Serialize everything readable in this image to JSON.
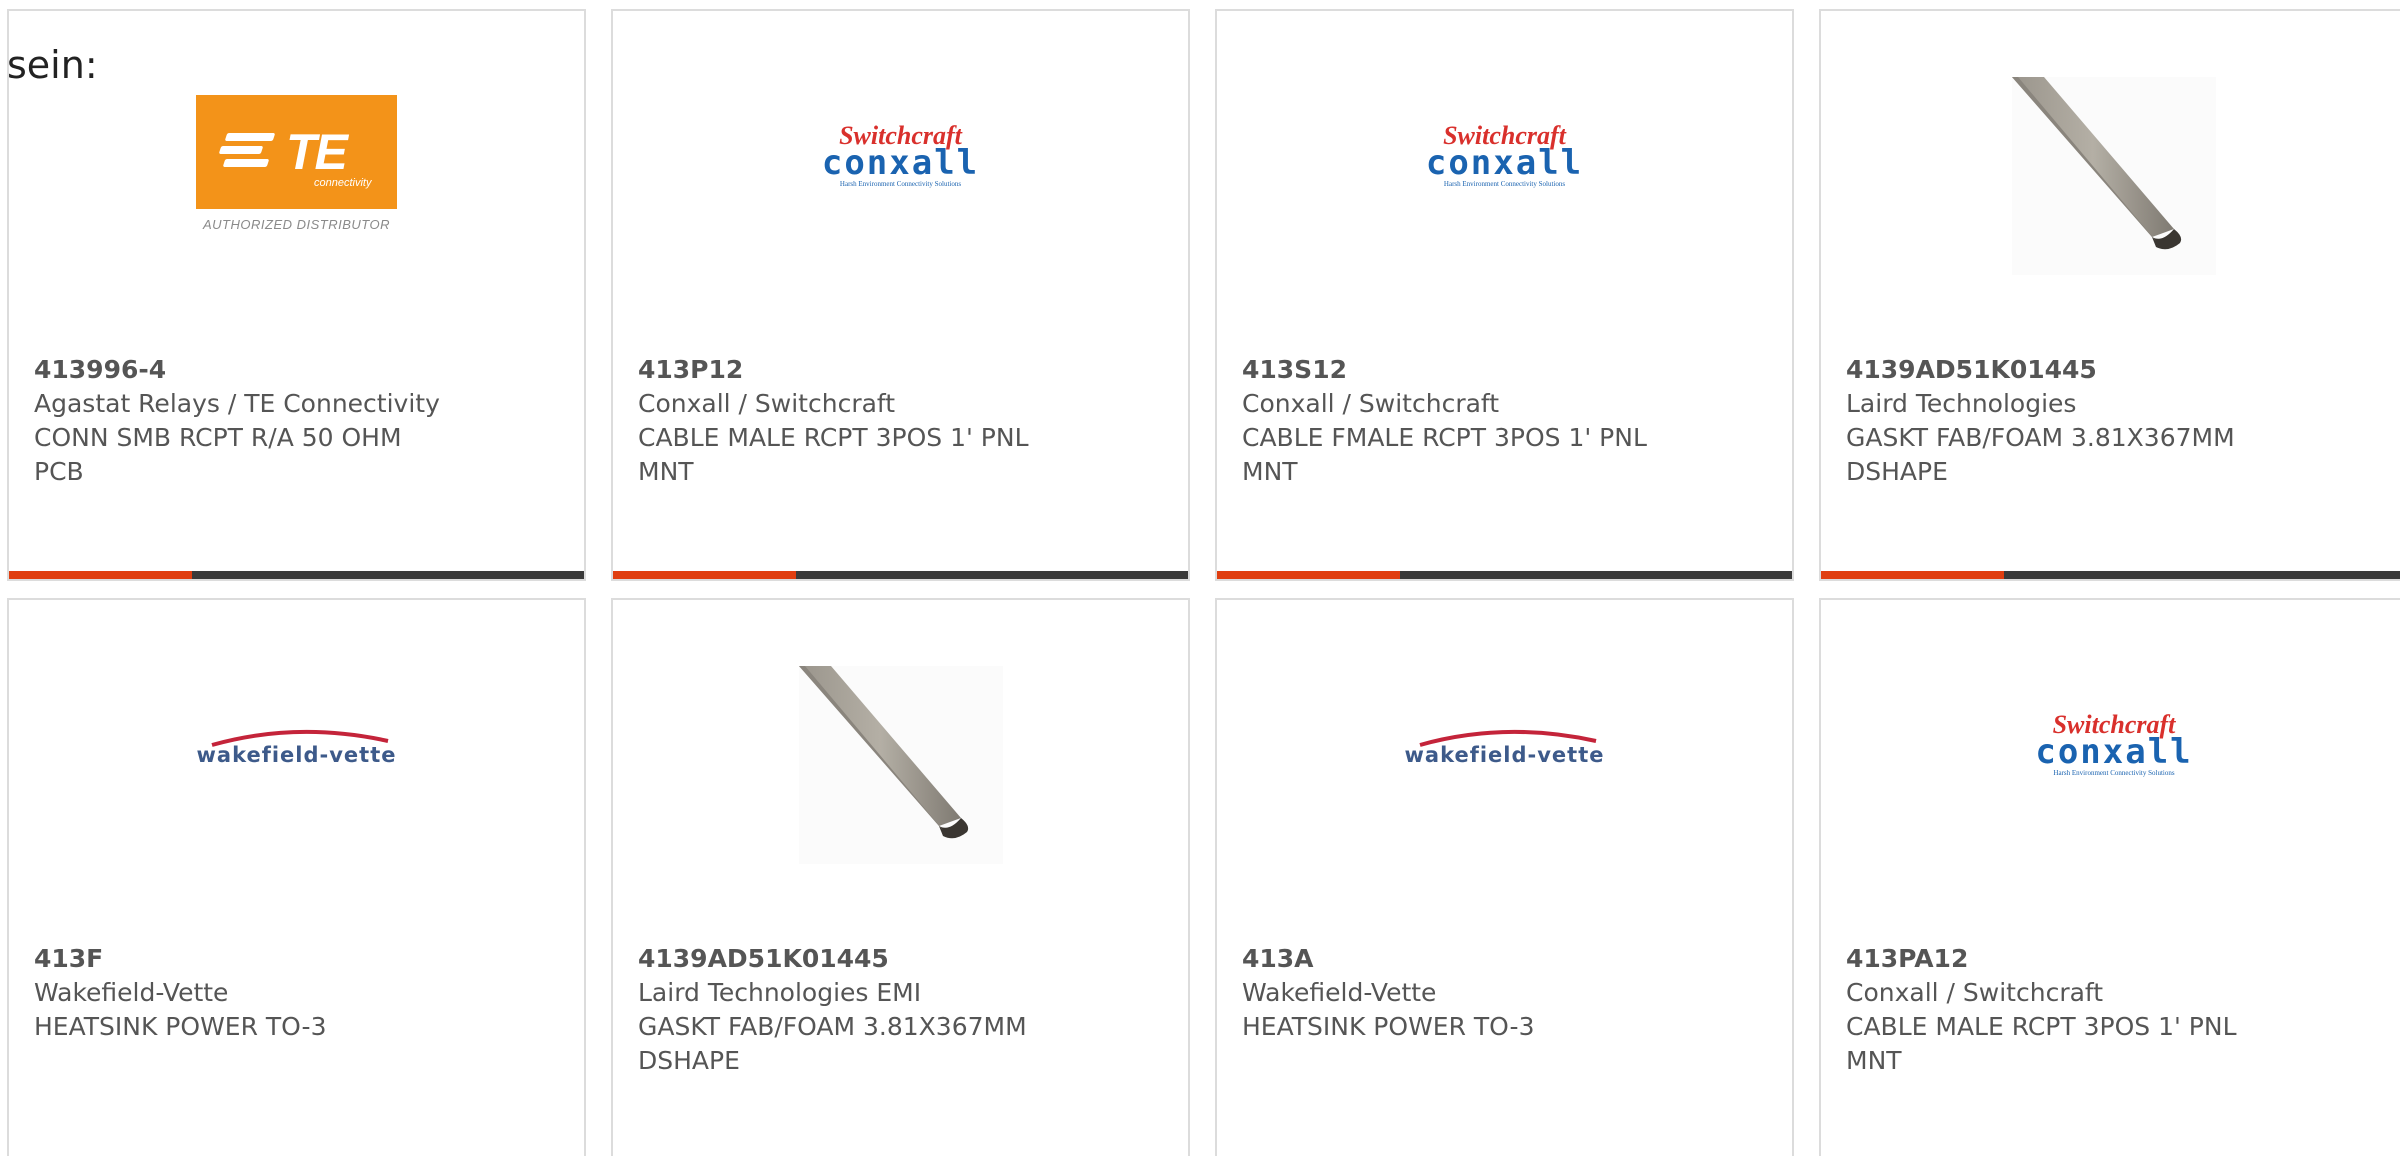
{
  "lead_text": "sein:",
  "products": [
    {
      "part_number": "413996-4",
      "manufacturer": "Agastat Relays / TE Connectivity",
      "description": "CONN SMB RCPT R/A 50 OHM PCB",
      "logo": "te-connectivity-logo",
      "logo_text": {
        "mark": "TE",
        "sub": "connectivity",
        "caption": "AUTHORIZED DISTRIBUTOR"
      }
    },
    {
      "part_number": "413P12",
      "manufacturer": "Conxall / Switchcraft",
      "description": "CABLE MALE RCPT 3POS 1' PNL MNT",
      "logo": "switchcraft-conxall-logo",
      "logo_text": {
        "top": "Switchcraft",
        "bottom": "conxall",
        "tagline": "Harsh Environment Connectivity Solutions"
      }
    },
    {
      "part_number": "413S12",
      "manufacturer": "Conxall / Switchcraft",
      "description": "CABLE FMALE RCPT 3POS 1' PNL MNT",
      "logo": "switchcraft-conxall-logo",
      "logo_text": {
        "top": "Switchcraft",
        "bottom": "conxall",
        "tagline": "Harsh Environment Connectivity Solutions"
      }
    },
    {
      "part_number": "4139AD51K01445",
      "manufacturer": "Laird Technologies",
      "description": "GASKT FAB/FOAM 3.81X367MM DSHAPE",
      "logo": "gasket-product-photo"
    },
    {
      "part_number": "413F",
      "manufacturer": "Wakefield-Vette",
      "description": "HEATSINK POWER TO-3",
      "logo": "wakefield-vette-logo",
      "logo_text": {
        "name": "wakefield-vette"
      }
    },
    {
      "part_number": "4139AD51K01445",
      "manufacturer": "Laird Technologies EMI",
      "description": "GASKT FAB/FOAM 3.81X367MM DSHAPE",
      "logo": "gasket-product-photo"
    },
    {
      "part_number": "413A",
      "manufacturer": "Wakefield-Vette",
      "description": "HEATSINK POWER TO-3",
      "logo": "wakefield-vette-logo",
      "logo_text": {
        "name": "wakefield-vette"
      }
    },
    {
      "part_number": "413PA12",
      "manufacturer": "Conxall / Switchcraft",
      "description": "CABLE MALE RCPT 3POS 1' PNL MNT",
      "logo": "switchcraft-conxall-logo",
      "logo_text": {
        "top": "Switchcraft",
        "bottom": "conxall",
        "tagline": "Harsh Environment Connectivity Solutions"
      }
    }
  ],
  "colors": {
    "accent_bar": "#e03e10",
    "bar_dark": "#3a3a3a",
    "te_orange": "#f39319",
    "switchcraft_red": "#d9302c",
    "conxall_blue": "#1a63b0",
    "wakefield_blue": "#3d5a8a"
  }
}
